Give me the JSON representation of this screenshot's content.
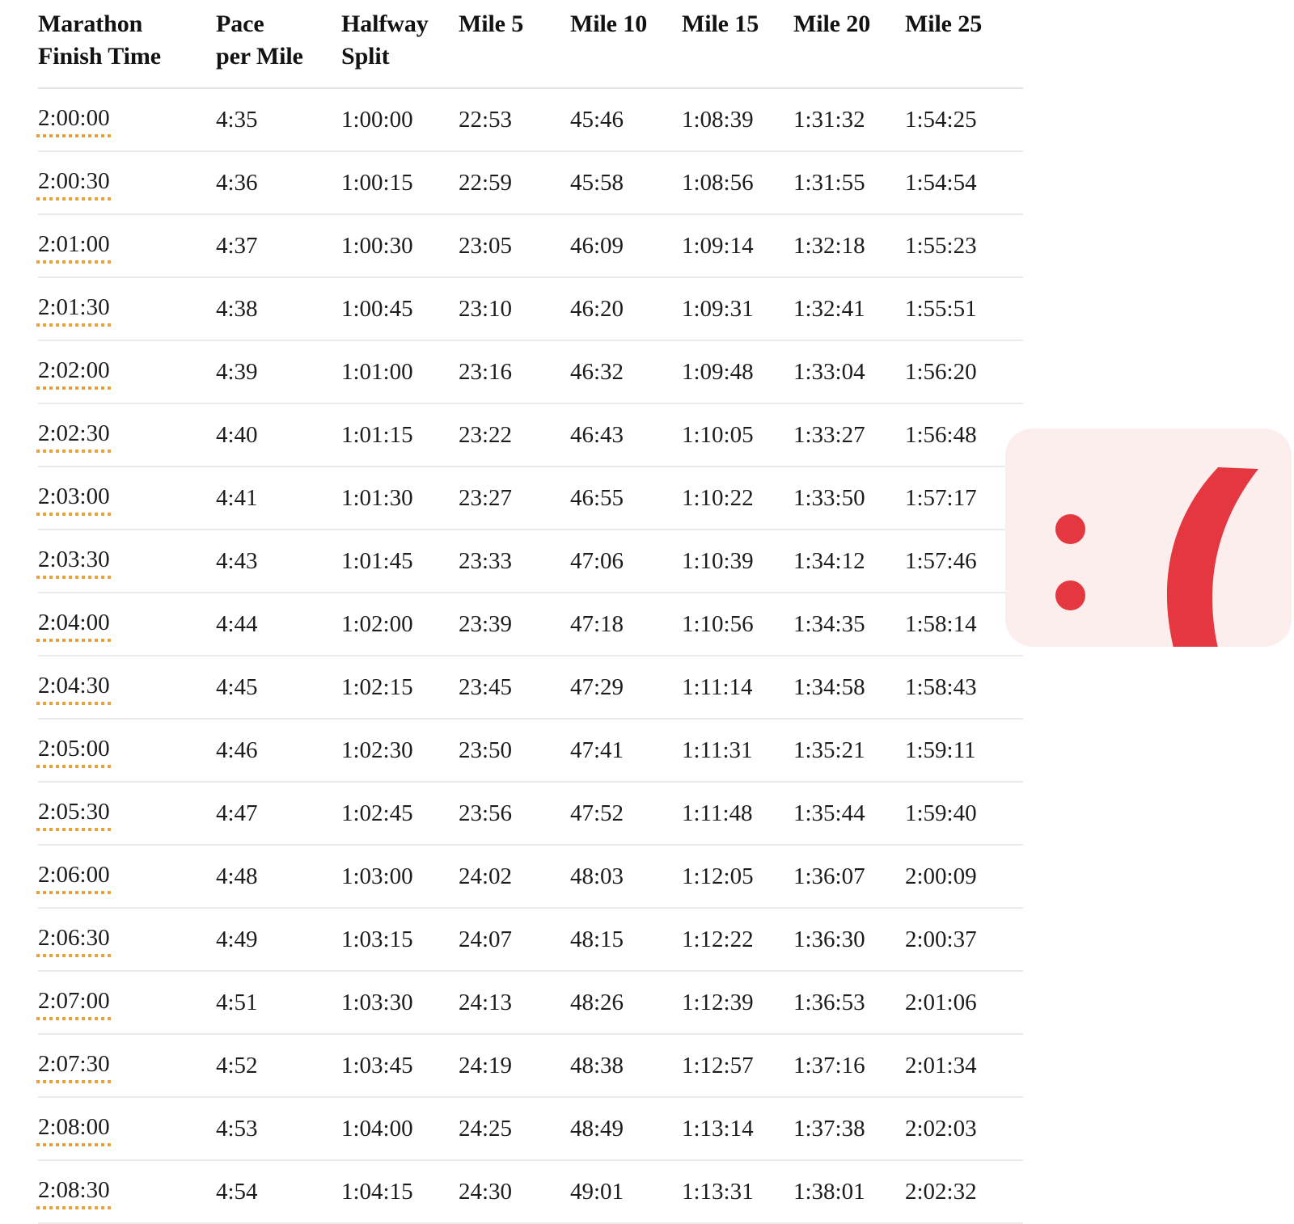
{
  "page": {
    "background_color": "#ffffff",
    "accent_underline_color": "#e8a33d",
    "rule_color": "#ebebeb"
  },
  "table": {
    "name": "marathon-pace-chart",
    "columns": [
      {
        "key": "finish",
        "label": "Marathon\nFinish Time"
      },
      {
        "key": "pace",
        "label": "Pace\nper Mile"
      },
      {
        "key": "halfway",
        "label": "Halfway\nSplit"
      },
      {
        "key": "mile5",
        "label": "Mile 5"
      },
      {
        "key": "mile10",
        "label": "Mile 10"
      },
      {
        "key": "mile15",
        "label": "Mile 15"
      },
      {
        "key": "mile20",
        "label": "Mile 20"
      },
      {
        "key": "mile25",
        "label": "Mile 25"
      }
    ],
    "rows": [
      [
        "2:00:00",
        "4:35",
        "1:00:00",
        "22:53",
        "45:46",
        "1:08:39",
        "1:31:32",
        "1:54:25"
      ],
      [
        "2:00:30",
        "4:36",
        "1:00:15",
        "22:59",
        "45:58",
        "1:08:56",
        "1:31:55",
        "1:54:54"
      ],
      [
        "2:01:00",
        "4:37",
        "1:00:30",
        "23:05",
        "46:09",
        "1:09:14",
        "1:32:18",
        "1:55:23"
      ],
      [
        "2:01:30",
        "4:38",
        "1:00:45",
        "23:10",
        "46:20",
        "1:09:31",
        "1:32:41",
        "1:55:51"
      ],
      [
        "2:02:00",
        "4:39",
        "1:01:00",
        "23:16",
        "46:32",
        "1:09:48",
        "1:33:04",
        "1:56:20"
      ],
      [
        "2:02:30",
        "4:40",
        "1:01:15",
        "23:22",
        "46:43",
        "1:10:05",
        "1:33:27",
        "1:56:48"
      ],
      [
        "2:03:00",
        "4:41",
        "1:01:30",
        "23:27",
        "46:55",
        "1:10:22",
        "1:33:50",
        "1:57:17"
      ],
      [
        "2:03:30",
        "4:43",
        "1:01:45",
        "23:33",
        "47:06",
        "1:10:39",
        "1:34:12",
        "1:57:46"
      ],
      [
        "2:04:00",
        "4:44",
        "1:02:00",
        "23:39",
        "47:18",
        "1:10:56",
        "1:34:35",
        "1:58:14"
      ],
      [
        "2:04:30",
        "4:45",
        "1:02:15",
        "23:45",
        "47:29",
        "1:11:14",
        "1:34:58",
        "1:58:43"
      ],
      [
        "2:05:00",
        "4:46",
        "1:02:30",
        "23:50",
        "47:41",
        "1:11:31",
        "1:35:21",
        "1:59:11"
      ],
      [
        "2:05:30",
        "4:47",
        "1:02:45",
        "23:56",
        "47:52",
        "1:11:48",
        "1:35:44",
        "1:59:40"
      ],
      [
        "2:06:00",
        "4:48",
        "1:03:00",
        "24:02",
        "48:03",
        "1:12:05",
        "1:36:07",
        "2:00:09"
      ],
      [
        "2:06:30",
        "4:49",
        "1:03:15",
        "24:07",
        "48:15",
        "1:12:22",
        "1:36:30",
        "2:00:37"
      ],
      [
        "2:07:00",
        "4:51",
        "1:03:30",
        "24:13",
        "48:26",
        "1:12:39",
        "1:36:53",
        "2:01:06"
      ],
      [
        "2:07:30",
        "4:52",
        "1:03:45",
        "24:19",
        "48:38",
        "1:12:57",
        "1:37:16",
        "2:01:34"
      ],
      [
        "2:08:00",
        "4:53",
        "1:04:00",
        "24:25",
        "48:49",
        "1:13:14",
        "1:37:38",
        "2:02:03"
      ],
      [
        "2:08:30",
        "4:54",
        "1:04:15",
        "24:30",
        "49:01",
        "1:13:31",
        "1:38:01",
        "2:02:32"
      ]
    ]
  },
  "sad_face_card": {
    "icon_name": "sad-face-emoticon",
    "background_color": "#fdeeee",
    "mark_color": "#e5373f"
  }
}
